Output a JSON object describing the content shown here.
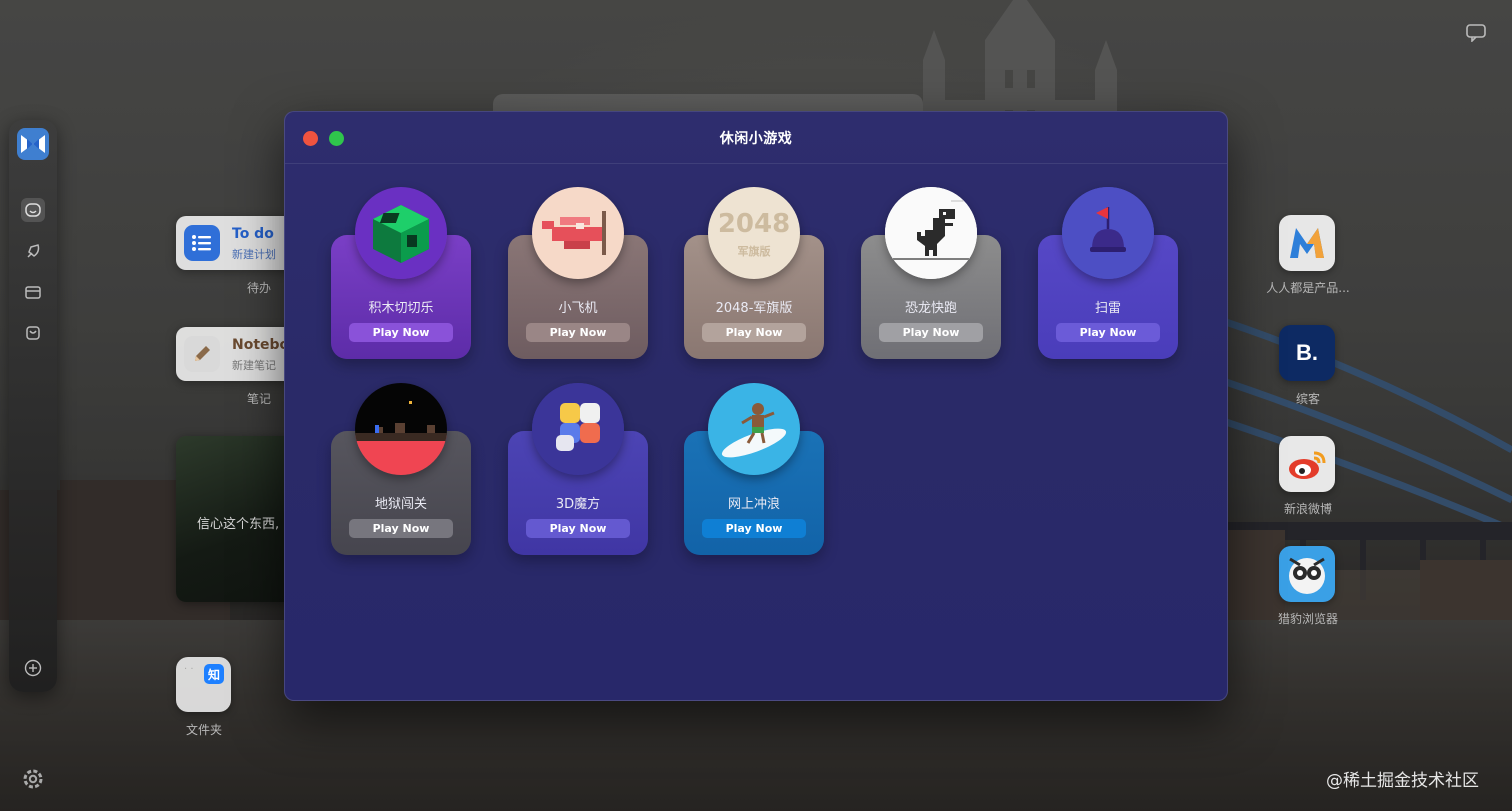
{
  "window": {
    "title": "休闲小游戏"
  },
  "games": [
    {
      "name": "积木切切乐",
      "play": "Play Now"
    },
    {
      "name": "小飞机",
      "play": "Play Now"
    },
    {
      "name": "2048-军旗版",
      "play": "Play Now",
      "thumb_top": "2048",
      "thumb_bottom": "军旗版"
    },
    {
      "name": "恐龙快跑",
      "play": "Play Now"
    },
    {
      "name": "扫雷",
      "play": "Play Now"
    },
    {
      "name": "地狱闯关",
      "play": "Play Now"
    },
    {
      "name": "3D魔方",
      "play": "Play Now"
    },
    {
      "name": "网上冲浪",
      "play": "Play Now"
    }
  ],
  "widgets": {
    "todo": {
      "title": "To do",
      "subtitle": "新建计划",
      "caption": "待办"
    },
    "notebook": {
      "title": "Notebo",
      "subtitle": "新建笔记",
      "caption": "笔记"
    },
    "quote": {
      "text": "信心这个东西,"
    },
    "folder": {
      "caption": "文件夹",
      "badge": "知"
    }
  },
  "apps": [
    {
      "label": "人人都是产品...",
      "glyph": "M"
    },
    {
      "label": "缤客",
      "glyph": "B."
    },
    {
      "label": "新浪微博"
    },
    {
      "label": "猎豹浏览器"
    }
  ],
  "watermark": "@稀土掘金技术社区",
  "colors": {
    "modal_bg": "#2b2a6b",
    "close": "#f0533f",
    "zoom": "#2fc54c"
  }
}
